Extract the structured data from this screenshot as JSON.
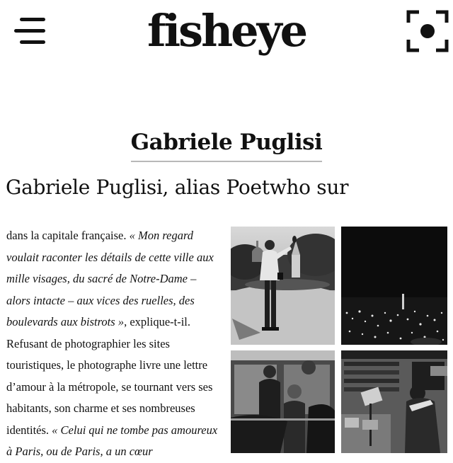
{
  "header": {
    "logo_text": "fisheye",
    "menu_icon": "hamburger-menu-icon",
    "fullscreen_icon": "fullscreen-focus-icon"
  },
  "article": {
    "title": "Gabriele Puglisi",
    "lead": "Gabriele Puglisi, alias Poetwho sur",
    "body": {
      "s1": "dans la capitale française. ",
      "q1": "« Mon regard voulait raconter les détails de cette ville aux mille visages, du sacré de Notre-Dame – alors intacte – aux vices des ruelles, des boulevards aux bistrots »",
      "s2": ", explique-t-il. Refusant de photographier les sites touristiques, le photographe livre une lettre d’amour à la métropole, se tournant vers ses habitants, son charme et ses nombreuses identités. ",
      "q2": "« Celui qui ne tombe pas amoureux à Paris, ou de Paris, a un cœur"
    }
  },
  "gallery": {
    "photos": [
      "photo-1",
      "photo-2",
      "photo-3",
      "photo-4"
    ]
  },
  "colors": {
    "text": "#111111",
    "background": "#ffffff",
    "title_underline": "#b8b8b8"
  }
}
